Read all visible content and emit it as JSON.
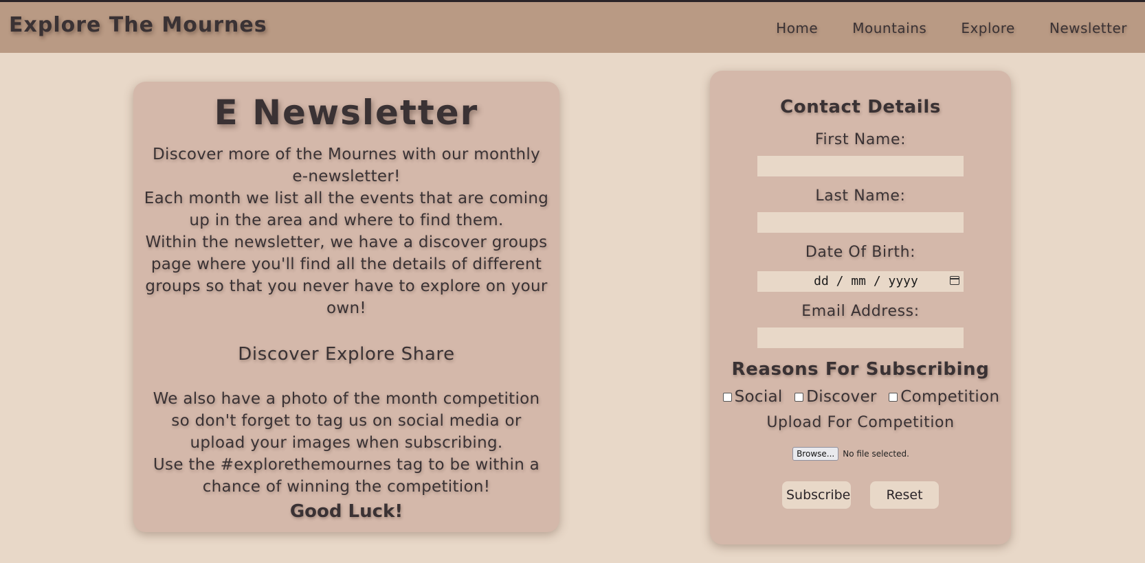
{
  "header": {
    "site_title": "Explore The Mournes",
    "nav": [
      "Home",
      "Mountains",
      "Explore",
      "Newsletter"
    ]
  },
  "newsletter": {
    "title": "E Newsletter",
    "paragraph1": "Discover more of the Mournes with our monthly e-newsletter!",
    "paragraph1b": "Each month we list all the events that are coming up in the area and where to find them.",
    "paragraph2": "Within the newsletter, we have a discover groups page where you'll find all the details of different groups so that you never have to explore on your own!",
    "tagline": "Discover Explore Share",
    "paragraph3": "We also have a photo of the month competition so don't forget to tag us on social media or upload your images when subscribing.",
    "paragraph4": "Use the #explorethemournes tag to be within a chance of winning the competition!",
    "sign_off": "Good Luck!"
  },
  "form": {
    "title": "Contact Details",
    "first_name_label": "First Name:",
    "last_name_label": "Last Name:",
    "dob_label": "Date Of Birth:",
    "dob_placeholder": "dd / mm / yyyy",
    "email_label": "Email Address:",
    "reasons_title": "Reasons For Subscribing",
    "reasons": [
      "Social",
      "Discover",
      "Competition"
    ],
    "upload_label": "Upload For Competition",
    "browse_label": "Browse...",
    "file_status": "No file selected.",
    "subscribe_label": "Subscribe",
    "reset_label": "Reset"
  },
  "colors": {
    "page_background": "#e8d8c8",
    "header_background": "#b99a84",
    "card_background": "#d4b8aa",
    "text": "#3a3234"
  }
}
